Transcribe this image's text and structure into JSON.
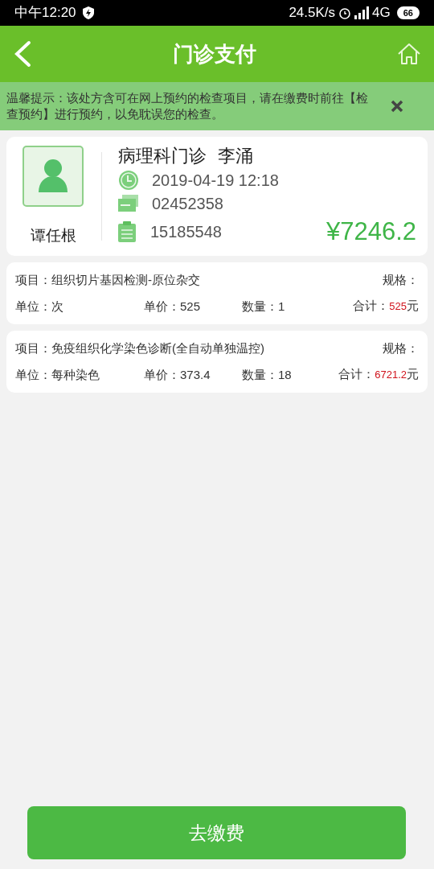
{
  "status_bar": {
    "time": "中午12:20",
    "speed": "24.5K/s",
    "network": "4G",
    "battery": "66"
  },
  "header": {
    "title": "门诊支付"
  },
  "notice": {
    "text": "温馨提示：该处方含可在网上预约的检查项目，请在缴费时前往【检查预约】进行预约，以免耽误您的检查。"
  },
  "patient": {
    "name": "谭任根",
    "department": "病理科门诊",
    "doctor": "李涌",
    "time": "2019-04-19 12:18",
    "card_no": "02452358",
    "order_no": "15185548",
    "total": "¥7246.2"
  },
  "items": [
    {
      "project": "项目：组织切片基因检测-原位杂交",
      "spec": "规格：",
      "unit": "单位：次",
      "price": "单价：525",
      "qty": "数量：1",
      "sum_label": "合计：",
      "sum": "525",
      "currency": "元"
    },
    {
      "project": "项目：免疫组织化学染色诊断(全自动单独温控)",
      "spec": "规格：",
      "unit": "单位：每种染色",
      "price": "单价：373.4",
      "qty": "数量：18",
      "sum_label": "合计：",
      "sum": "6721.2",
      "currency": "元"
    }
  ],
  "pay_button": "去缴费"
}
